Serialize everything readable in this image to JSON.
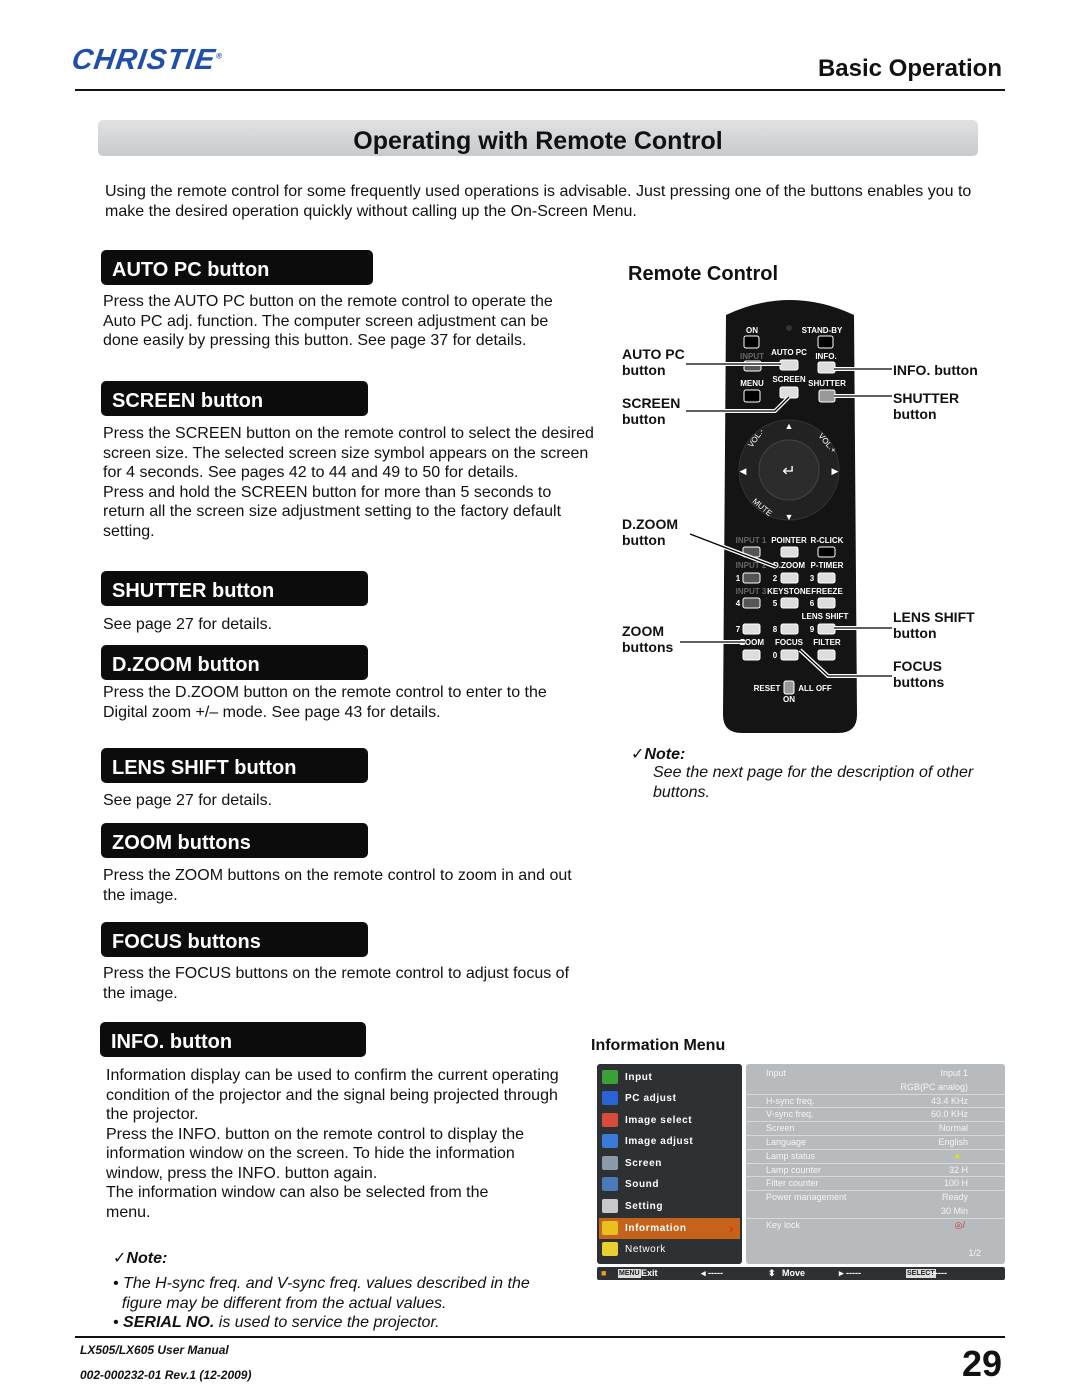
{
  "header": {
    "logo": "CHRISTIE",
    "section": "Basic Operation"
  },
  "page_title": "Operating with Remote Control",
  "intro": "Using the remote control for some frequently used operations is advisable. Just pressing one of the buttons enables you to make the desired operation quickly without calling up the On-Screen Menu.",
  "sections": [
    {
      "title": "AUTO PC button",
      "text": [
        "Press the AUTO PC button on the remote control to operate the",
        "Auto PC adj. function. The computer screen adjustment can be",
        "done easily by pressing this button. See page 37 for details."
      ]
    },
    {
      "title": "SCREEN button",
      "text": [
        "Press the SCREEN button on the remote control to select the desired",
        "screen size. The selected screen size symbol appears on the screen",
        "for 4 seconds. See pages 42 to 44 and 49 to 50 for details.",
        "Press and hold the SCREEN button for more than 5 seconds to",
        "return all the screen size adjustment setting to the factory default",
        "setting."
      ]
    },
    {
      "title": "SHUTTER button",
      "text": [
        "See page 27 for details."
      ]
    },
    {
      "title": "D.ZOOM button",
      "text": [
        "Press the D.ZOOM button on the remote control to enter to the",
        "Digital zoom +/– mode. See page 43 for details."
      ]
    },
    {
      "title": "LENS SHIFT button",
      "text": [
        "See page 27 for details."
      ]
    },
    {
      "title": "ZOOM buttons",
      "text": [
        "Press the ZOOM buttons on the remote control to zoom in and out",
        "the image."
      ]
    },
    {
      "title": "FOCUS buttons",
      "text": [
        "Press the FOCUS buttons on the remote control to adjust focus of",
        "the image."
      ]
    },
    {
      "title": "INFO. button",
      "text": [
        "Information display can be used to confirm the current operating",
        "condition of the projector and the signal being projected through",
        "the projector.",
        "Press the INFO. button on the remote control to display the",
        "information window on the screen. To hide the information",
        "window, press the INFO. button again.",
        "The information window can also be selected from the",
        "menu."
      ]
    }
  ],
  "info_note": {
    "title": "Note:",
    "bullets": [
      "The H-sync freq. and V-sync freq. values described in the figure may be different from the actual values.",
      "SERIAL NO. is used to service the projector."
    ],
    "b1a": "The H-sync freq. and V-sync freq. values described in the",
    "b1b": "figure may be different from the actual values.",
    "b2bold": "SERIAL NO.",
    "b2rest": " is used to service the projector."
  },
  "remote": {
    "title": "Remote Control",
    "callouts": {
      "autopc": "AUTO PC",
      "autopc2": "button",
      "screen": "SCREEN",
      "screen2": "button",
      "dzoom": "D.ZOOM",
      "dzoom2": "button",
      "zoom": "ZOOM",
      "zoom2": "buttons",
      "info": "INFO. button",
      "shutter": "SHUTTER",
      "shutter2": "button",
      "lens": "LENS SHIFT",
      "lens2": "button",
      "focus": "FOCUS",
      "focus2": "buttons"
    },
    "keys": {
      "on": "ON",
      "standby": "STAND-BY",
      "input": "INPUT",
      "autopc": "AUTO PC",
      "info": "INFO.",
      "menu": "MENU",
      "screen": "SCREEN",
      "shutter": "SHUTTER",
      "volm": "VOL.-",
      "volp": "VOL.+",
      "mute": "MUTE",
      "input1": "INPUT 1",
      "pointer": "POINTER",
      "rclick": "R-CLICK",
      "input2": "INPUT 2",
      "dzoom": "D.ZOOM",
      "ptimer": "P-TIMER",
      "input3": "INPUT 3",
      "keystone": "KEYSTONE",
      "freeze": "FREEZE",
      "lensshift": "LENS SHIFT",
      "zoom": "ZOOM",
      "focus": "FOCUS",
      "filter": "FILTER",
      "reset": "RESET",
      "alloff": "ALL OFF",
      "on2": "ON",
      "n1": "1",
      "n2": "2",
      "n3": "3",
      "n4": "4",
      "n5": "5",
      "n6": "6",
      "n7": "7",
      "n8": "8",
      "n9": "9",
      "n0": "0"
    },
    "note_title": "Note:",
    "note_a": "See the next page for the description of other",
    "note_b": "buttons."
  },
  "info_menu": {
    "title": "Information Menu",
    "items": [
      {
        "label": "Input",
        "color": "#3aa13a"
      },
      {
        "label": "PC adjust",
        "color": "#2a62d8"
      },
      {
        "label": "Image select",
        "color": "#d84a3a"
      },
      {
        "label": "Image adjust",
        "color": "#3a7ad8"
      },
      {
        "label": "Screen",
        "color": "#8a9aa8"
      },
      {
        "label": "Sound",
        "color": "#4a7ab8"
      },
      {
        "label": "Setting",
        "color": "#c8c8c8"
      },
      {
        "label": "Information",
        "color": "#e8c020",
        "selected": true
      },
      {
        "label": "Network",
        "color": "#e8d030"
      }
    ],
    "rows": [
      {
        "k": "Input",
        "v": "Input 1"
      },
      {
        "k": "",
        "v": "RGB(PC analog)"
      },
      {
        "k": "H-sync freq.",
        "v": "43.4 KHz"
      },
      {
        "k": "V-sync freq.",
        "v": "60.0 KHz"
      },
      {
        "k": "Screen",
        "v": "Normal"
      },
      {
        "k": "Language",
        "v": "English"
      },
      {
        "k": "Lamp status",
        "v": ""
      },
      {
        "k": "Lamp counter",
        "v": "32 H"
      },
      {
        "k": "Filter counter",
        "v": "100 H"
      },
      {
        "k": "Power management",
        "v": "Ready"
      },
      {
        "k": "",
        "v": "30 Min"
      },
      {
        "k": "Key lock",
        "v": ""
      }
    ],
    "page": "1/2",
    "bar": {
      "menu_key": "MENU",
      "exit": "Exit",
      "left": "-----",
      "move": "Move",
      "right": "-----",
      "select_key": "SELECT",
      "select": "-----"
    }
  },
  "footer": {
    "manual": "LX505/LX605 User Manual",
    "doc": "002-000232-01 Rev.1 (12-2009)",
    "page": "29"
  }
}
